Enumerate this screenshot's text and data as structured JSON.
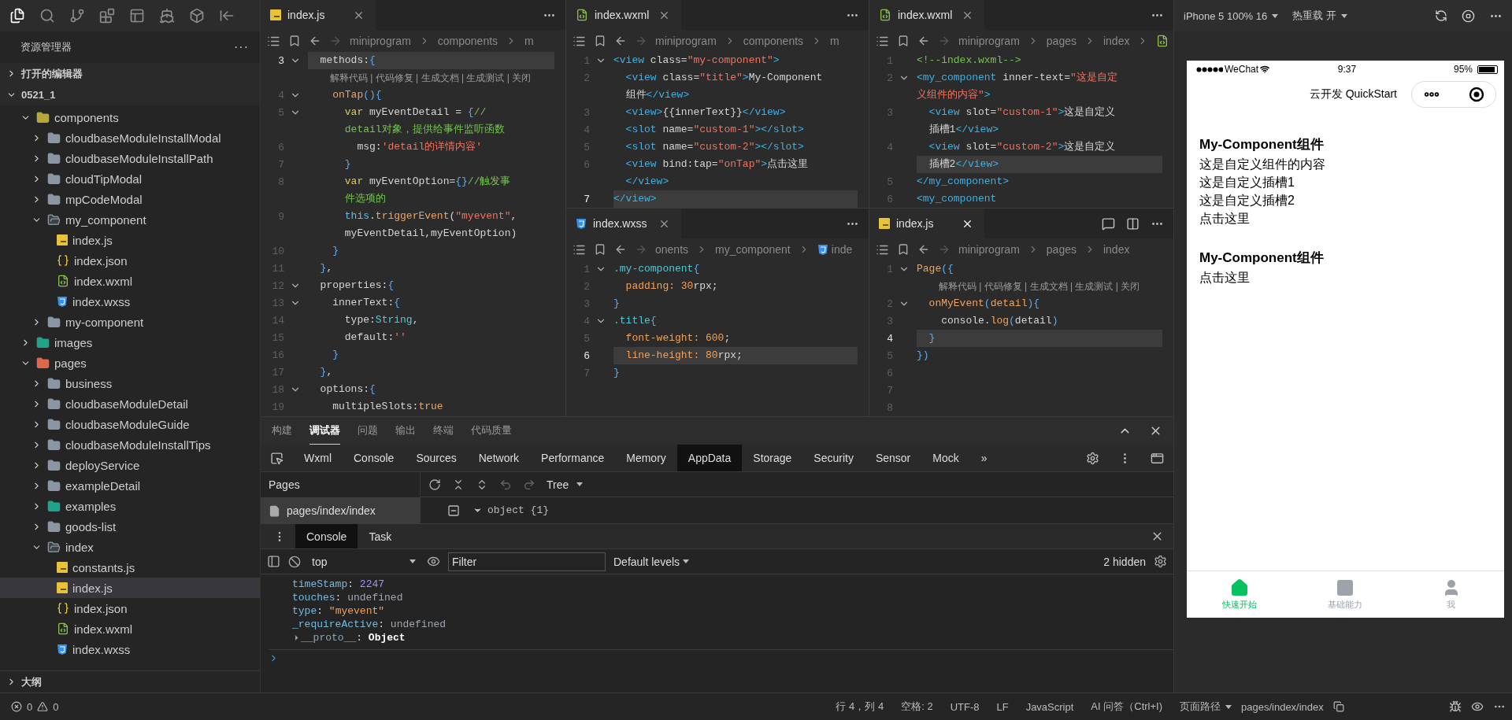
{
  "activity_bar": [
    {
      "selected": true
    },
    {
      "selected": false
    },
    {
      "selected": false
    },
    {
      "selected": false
    },
    {
      "selected": false
    },
    {
      "selected": false
    },
    {
      "selected": false
    },
    {
      "selected": false
    }
  ],
  "sidebar": {
    "title": "资源管理器",
    "more": "···",
    "sections": [
      {
        "label": "打开的编辑器",
        "expanded": false
      },
      {
        "label": "0521_1",
        "expanded": true
      }
    ],
    "tree": [
      {
        "name": "components",
        "kind": "components",
        "expanded": true,
        "selected": false,
        "children": [
          {
            "name": "cloudbaseModuleInstallModal",
            "kind": "folder",
            "expanded": false,
            "selected": false
          },
          {
            "name": "cloudbaseModuleInstallPath",
            "kind": "folder",
            "expanded": false,
            "selected": false
          },
          {
            "name": "cloudTipModal",
            "kind": "folder",
            "expanded": false,
            "selected": false
          },
          {
            "name": "mpCodeModal",
            "kind": "folder",
            "expanded": false,
            "selected": false
          },
          {
            "name": "my_component",
            "kind": "folder",
            "expanded": true,
            "selected": false,
            "children": [
              {
                "name": "index.js",
                "kind": "js",
                "selected": false
              },
              {
                "name": "index.json",
                "kind": "json",
                "selected": false
              },
              {
                "name": "index.wxml",
                "kind": "wxml",
                "selected": false
              },
              {
                "name": "index.wxss",
                "kind": "wxss",
                "selected": false
              }
            ]
          },
          {
            "name": "my-component",
            "kind": "folder",
            "expanded": false,
            "selected": false
          }
        ]
      },
      {
        "name": "images",
        "kind": "images",
        "expanded": false,
        "selected": false
      },
      {
        "name": "pages",
        "kind": "pages",
        "expanded": true,
        "selected": false,
        "children": [
          {
            "name": "business",
            "kind": "folder",
            "expanded": false,
            "selected": false
          },
          {
            "name": "cloudbaseModuleDetail",
            "kind": "folder",
            "expanded": false,
            "selected": false
          },
          {
            "name": "cloudbaseModuleGuide",
            "kind": "folder",
            "expanded": false,
            "selected": false
          },
          {
            "name": "cloudbaseModuleInstallTips",
            "kind": "folder",
            "expanded": false,
            "selected": false
          },
          {
            "name": "deployService",
            "kind": "folder",
            "expanded": false,
            "selected": false
          },
          {
            "name": "exampleDetail",
            "kind": "folder",
            "expanded": false,
            "selected": false
          },
          {
            "name": "examples",
            "kind": "images",
            "expanded": false,
            "selected": false
          },
          {
            "name": "goods-list",
            "kind": "folder",
            "expanded": false,
            "selected": false
          },
          {
            "name": "index",
            "kind": "folder",
            "expanded": true,
            "selected": false,
            "children": [
              {
                "name": "constants.js",
                "kind": "js",
                "selected": false
              },
              {
                "name": "index.js",
                "kind": "js",
                "selected": true
              },
              {
                "name": "index.json",
                "kind": "json",
                "selected": false
              },
              {
                "name": "index.wxml",
                "kind": "wxml",
                "selected": false
              },
              {
                "name": "index.wxss",
                "kind": "wxss",
                "selected": false
              }
            ]
          }
        ]
      }
    ],
    "outline": {
      "label": "大纲",
      "expanded": false
    }
  },
  "editor_groups": [
    {
      "panes": [
        {
          "tab": {
            "label": "index.js",
            "kind": "js",
            "selected": true
          },
          "focused": false,
          "breadcrumb": [
            {
              "label": "miniprogram"
            },
            {
              "label": "components"
            },
            {
              "label": "m"
            }
          ],
          "lines": [
            {
              "kind": "code",
              "num": "3",
              "fold": true,
              "current": true,
              "tokens": [
                {
                  "kind": "plain",
                  "text": "  methods:"
                },
                {
                  "kind": "br",
                  "text": "{"
                }
              ]
            },
            {
              "kind": "lens",
              "text": "解释代码 | 代码修复 | 生成文档 | 生成测试 | 关闭"
            },
            {
              "kind": "code",
              "num": "4",
              "fold": true,
              "current": false,
              "tokens": [
                {
                  "kind": "fn",
                  "text": "    onTap"
                },
                {
                  "kind": "br",
                  "text": "(){"
                }
              ]
            },
            {
              "kind": "code",
              "num": "5",
              "fold": true,
              "current": false,
              "tokens": [
                {
                  "kind": "kw",
                  "text": "      var"
                },
                {
                  "kind": "plain",
                  "text": " myEventDetail = "
                },
                {
                  "kind": "br",
                  "text": "{"
                },
                {
                  "kind": "com",
                  "text": "//"
                }
              ]
            },
            {
              "kind": "wrap",
              "current": false,
              "tokens": [
                {
                  "kind": "com",
                  "text": "      detail对象，提供给事件监听函数"
                }
              ]
            },
            {
              "kind": "code",
              "num": "6",
              "fold": false,
              "current": false,
              "tokens": [
                {
                  "kind": "plain",
                  "text": "        msg:"
                },
                {
                  "kind": "str",
                  "text": "'detail的详情内容'"
                }
              ]
            },
            {
              "kind": "code",
              "num": "7",
              "fold": false,
              "current": false,
              "tokens": [
                {
                  "kind": "br",
                  "text": "      }"
                }
              ]
            },
            {
              "kind": "code",
              "num": "8",
              "fold": false,
              "current": false,
              "tokens": [
                {
                  "kind": "kw",
                  "text": "      var"
                },
                {
                  "kind": "plain",
                  "text": " myEventOption="
                },
                {
                  "kind": "br",
                  "text": "{}"
                },
                {
                  "kind": "com",
                  "text": "//触发事"
                }
              ]
            },
            {
              "kind": "wrap",
              "current": false,
              "tokens": [
                {
                  "kind": "com",
                  "text": "      件选项的"
                }
              ]
            },
            {
              "kind": "code",
              "num": "9",
              "fold": false,
              "current": false,
              "tokens": [
                {
                  "kind": "this",
                  "text": "      this"
                },
                {
                  "kind": "plain",
                  "text": "."
                },
                {
                  "kind": "fn",
                  "text": "triggerEvent"
                },
                {
                  "kind": "plain",
                  "text": "("
                },
                {
                  "kind": "str",
                  "text": "\"myevent\""
                },
                {
                  "kind": "plain",
                  "text": ","
                }
              ]
            },
            {
              "kind": "wrap",
              "current": false,
              "tokens": [
                {
                  "kind": "plain",
                  "text": "      myEventDetail,myEventOption)"
                }
              ]
            },
            {
              "kind": "code",
              "num": "10",
              "fold": false,
              "current": false,
              "tokens": [
                {
                  "kind": "br",
                  "text": "    }"
                }
              ]
            },
            {
              "kind": "code",
              "num": "11",
              "fold": false,
              "current": false,
              "tokens": [
                {
                  "kind": "br",
                  "text": "  }"
                },
                {
                  "kind": "plain",
                  "text": ","
                }
              ]
            },
            {
              "kind": "code",
              "num": "12",
              "fold": true,
              "current": false,
              "tokens": [
                {
                  "kind": "plain",
                  "text": "  properties:"
                },
                {
                  "kind": "br",
                  "text": "{"
                }
              ]
            },
            {
              "kind": "code",
              "num": "13",
              "fold": true,
              "current": false,
              "tokens": [
                {
                  "kind": "plain",
                  "text": "    innerText:"
                },
                {
                  "kind": "br",
                  "text": "{"
                }
              ]
            },
            {
              "kind": "code",
              "num": "14",
              "fold": false,
              "current": false,
              "tokens": [
                {
                  "kind": "plain",
                  "text": "      type:"
                },
                {
                  "kind": "type",
                  "text": "String"
                },
                {
                  "kind": "plain",
                  "text": ","
                }
              ]
            },
            {
              "kind": "code",
              "num": "15",
              "fold": false,
              "current": false,
              "tokens": [
                {
                  "kind": "plain",
                  "text": "      default:"
                },
                {
                  "kind": "str",
                  "text": "''"
                }
              ]
            },
            {
              "kind": "code",
              "num": "16",
              "fold": false,
              "current": false,
              "tokens": [
                {
                  "kind": "br",
                  "text": "    }"
                }
              ]
            },
            {
              "kind": "code",
              "num": "17",
              "fold": false,
              "current": false,
              "tokens": [
                {
                  "kind": "br",
                  "text": "  }"
                },
                {
                  "kind": "plain",
                  "text": ","
                }
              ]
            },
            {
              "kind": "code",
              "num": "18",
              "fold": true,
              "current": false,
              "tokens": [
                {
                  "kind": "plain",
                  "text": "  options:"
                },
                {
                  "kind": "br",
                  "text": "{"
                }
              ]
            },
            {
              "kind": "code",
              "num": "19",
              "fold": false,
              "current": false,
              "tokens": [
                {
                  "kind": "plain",
                  "text": "    multipleSlots:"
                },
                {
                  "kind": "fn",
                  "text": "true"
                }
              ]
            }
          ]
        }
      ]
    },
    {
      "panes": [
        {
          "tab": {
            "label": "index.wxml",
            "kind": "wxml",
            "selected": true
          },
          "focused": false,
          "breadcrumb": [
            {
              "label": "miniprogram"
            },
            {
              "label": "components"
            },
            {
              "label": "m"
            }
          ],
          "lines": [
            {
              "kind": "code",
              "num": "1",
              "fold": true,
              "current": false,
              "tokens": [
                {
                  "kind": "tag",
                  "text": "<view"
                },
                {
                  "kind": "plain",
                  "text": " class="
                },
                {
                  "kind": "str",
                  "text": "\"my-component\""
                },
                {
                  "kind": "tag",
                  "text": ">"
                }
              ]
            },
            {
              "kind": "code",
              "num": "2",
              "fold": false,
              "current": false,
              "tokens": [
                {
                  "kind": "tag",
                  "text": "  <view"
                },
                {
                  "kind": "plain",
                  "text": " class="
                },
                {
                  "kind": "str",
                  "text": "\"title\""
                },
                {
                  "kind": "tag",
                  "text": ">"
                },
                {
                  "kind": "plain",
                  "text": "My-Component"
                }
              ]
            },
            {
              "kind": "wrap",
              "current": false,
              "tokens": [
                {
                  "kind": "plain",
                  "text": "  组件"
                },
                {
                  "kind": "tag",
                  "text": "</view>"
                }
              ]
            },
            {
              "kind": "code",
              "num": "3",
              "fold": false,
              "current": false,
              "tokens": [
                {
                  "kind": "tag",
                  "text": "  <view>"
                },
                {
                  "kind": "plain",
                  "text": "{{innerText}}"
                },
                {
                  "kind": "tag",
                  "text": "</view>"
                }
              ]
            },
            {
              "kind": "code",
              "num": "4",
              "fold": false,
              "current": false,
              "tokens": [
                {
                  "kind": "tag",
                  "text": "  <slot"
                },
                {
                  "kind": "plain",
                  "text": " name="
                },
                {
                  "kind": "str",
                  "text": "\"custom-1\""
                },
                {
                  "kind": "tag",
                  "text": "></slot>"
                }
              ]
            },
            {
              "kind": "code",
              "num": "5",
              "fold": false,
              "current": false,
              "tokens": [
                {
                  "kind": "tag",
                  "text": "  <slot"
                },
                {
                  "kind": "plain",
                  "text": " name="
                },
                {
                  "kind": "str",
                  "text": "\"custom-2\""
                },
                {
                  "kind": "tag",
                  "text": "></slot>"
                }
              ]
            },
            {
              "kind": "code",
              "num": "6",
              "fold": false,
              "current": false,
              "tokens": [
                {
                  "kind": "tag",
                  "text": "  <view"
                },
                {
                  "kind": "plain",
                  "text": " bind:tap="
                },
                {
                  "kind": "str",
                  "text": "\"onTap\""
                },
                {
                  "kind": "tag",
                  "text": ">"
                },
                {
                  "kind": "plain",
                  "text": "点击这里"
                }
              ]
            },
            {
              "kind": "wrap",
              "current": false,
              "tokens": [
                {
                  "kind": "tag",
                  "text": "  </view>"
                }
              ]
            },
            {
              "kind": "code",
              "num": "7",
              "fold": false,
              "current": true,
              "tokens": [
                {
                  "kind": "tag",
                  "text": "</view>"
                }
              ]
            }
          ]
        },
        {
          "tab": {
            "label": "index.wxss",
            "kind": "wxss",
            "selected": true
          },
          "focused": false,
          "breadcrumb": [
            {
              "label": "onents"
            },
            {
              "label": "my_component"
            },
            {
              "label": "inde",
              "kind": "wxss"
            }
          ],
          "lines": [
            {
              "kind": "code",
              "num": "1",
              "fold": true,
              "current": false,
              "tokens": [
                {
                  "kind": "sel",
                  "text": ".my-component"
                },
                {
                  "kind": "br",
                  "text": "{"
                }
              ]
            },
            {
              "kind": "code",
              "num": "2",
              "fold": false,
              "current": false,
              "tokens": [
                {
                  "kind": "prop",
                  "text": "  padding:"
                },
                {
                  "kind": "num",
                  "text": " 30"
                },
                {
                  "kind": "plain",
                  "text": "rpx;"
                }
              ]
            },
            {
              "kind": "code",
              "num": "3",
              "fold": false,
              "current": false,
              "tokens": [
                {
                  "kind": "br",
                  "text": "}"
                }
              ]
            },
            {
              "kind": "code",
              "num": "4",
              "fold": true,
              "current": false,
              "tokens": [
                {
                  "kind": "sel",
                  "text": ".title"
                },
                {
                  "kind": "br",
                  "text": "{"
                }
              ]
            },
            {
              "kind": "code",
              "num": "5",
              "fold": false,
              "current": false,
              "tokens": [
                {
                  "kind": "prop",
                  "text": "  font-weight:"
                },
                {
                  "kind": "num",
                  "text": " 600"
                },
                {
                  "kind": "plain",
                  "text": ";"
                }
              ]
            },
            {
              "kind": "code",
              "num": "6",
              "fold": false,
              "current": true,
              "tokens": [
                {
                  "kind": "prop",
                  "text": "  line-height:"
                },
                {
                  "kind": "num",
                  "text": " 80"
                },
                {
                  "kind": "plain",
                  "text": "rpx;"
                }
              ]
            },
            {
              "kind": "code",
              "num": "7",
              "fold": false,
              "current": false,
              "tokens": [
                {
                  "kind": "br",
                  "text": "}"
                }
              ]
            }
          ]
        }
      ]
    },
    {
      "panes": [
        {
          "tab": {
            "label": "index.wxml",
            "kind": "wxml",
            "selected": true
          },
          "focused": false,
          "breadcrumb": [
            {
              "label": "miniprogram"
            },
            {
              "label": "pages"
            },
            {
              "label": "index"
            },
            {
              "kind": "wxml"
            }
          ],
          "lines": [
            {
              "kind": "code",
              "num": "1",
              "fold": false,
              "current": false,
              "tokens": [
                {
                  "kind": "com",
                  "text": "<!--index.wxml-->"
                }
              ]
            },
            {
              "kind": "code",
              "num": "2",
              "fold": true,
              "current": false,
              "tokens": [
                {
                  "kind": "tag",
                  "text": "<my_component"
                },
                {
                  "kind": "plain",
                  "text": " inner-text="
                },
                {
                  "kind": "str",
                  "text": "\"这是自定"
                }
              ]
            },
            {
              "kind": "wrap",
              "current": false,
              "tokens": [
                {
                  "kind": "str",
                  "text": "义组件的内容\""
                },
                {
                  "kind": "tag",
                  "text": ">"
                }
              ]
            },
            {
              "kind": "code",
              "num": "3",
              "fold": false,
              "current": false,
              "tokens": [
                {
                  "kind": "tag",
                  "text": "  <view"
                },
                {
                  "kind": "plain",
                  "text": " slot="
                },
                {
                  "kind": "str",
                  "text": "\"custom-1\""
                },
                {
                  "kind": "tag",
                  "text": ">"
                },
                {
                  "kind": "plain",
                  "text": "这是自定义"
                }
              ]
            },
            {
              "kind": "wrap",
              "current": false,
              "tokens": [
                {
                  "kind": "plain",
                  "text": "  插槽1"
                },
                {
                  "kind": "tag",
                  "text": "</view>"
                }
              ]
            },
            {
              "kind": "code",
              "num": "4",
              "fold": false,
              "current": false,
              "tokens": [
                {
                  "kind": "tag",
                  "text": "  <view"
                },
                {
                  "kind": "plain",
                  "text": " slot="
                },
                {
                  "kind": "str",
                  "text": "\"custom-2\""
                },
                {
                  "kind": "tag",
                  "text": ">"
                },
                {
                  "kind": "plain",
                  "text": "这是自定义"
                }
              ]
            },
            {
              "kind": "wrap",
              "current": true,
              "tokens": [
                {
                  "kind": "plain",
                  "text": "  插槽2"
                },
                {
                  "kind": "tag",
                  "text": "</view>"
                }
              ]
            },
            {
              "kind": "code",
              "num": "5",
              "fold": false,
              "current": false,
              "tokens": [
                {
                  "kind": "tag",
                  "text": "</my_component>"
                }
              ]
            },
            {
              "kind": "code",
              "num": "6",
              "fold": false,
              "current": false,
              "tokens": [
                {
                  "kind": "tag",
                  "text": "<my_component"
                }
              ]
            }
          ]
        },
        {
          "tab": {
            "label": "index.js",
            "kind": "js",
            "selected": true
          },
          "focused": true,
          "breadcrumb": [
            {
              "label": "miniprogram"
            },
            {
              "label": "pages"
            },
            {
              "label": "index"
            }
          ],
          "lines": [
            {
              "kind": "code",
              "num": "1",
              "fold": true,
              "current": false,
              "tokens": [
                {
                  "kind": "fn",
                  "text": "Page"
                },
                {
                  "kind": "br",
                  "text": "({"
                }
              ]
            },
            {
              "kind": "lens",
              "text": "解释代码 | 代码修复 | 生成文档 | 生成测试 | 关闭"
            },
            {
              "kind": "code",
              "num": "2",
              "fold": true,
              "current": false,
              "tokens": [
                {
                  "kind": "fn",
                  "text": "  onMyEvent"
                },
                {
                  "kind": "br",
                  "text": "("
                },
                {
                  "kind": "fn",
                  "text": "detail"
                },
                {
                  "kind": "br",
                  "text": "){"
                }
              ]
            },
            {
              "kind": "code",
              "num": "3",
              "fold": false,
              "current": false,
              "tokens": [
                {
                  "kind": "plain",
                  "text": "    console."
                },
                {
                  "kind": "fn",
                  "text": "log"
                },
                {
                  "kind": "br",
                  "text": "("
                },
                {
                  "kind": "plain",
                  "text": "detail"
                },
                {
                  "kind": "br",
                  "text": ")"
                }
              ]
            },
            {
              "kind": "code",
              "num": "4",
              "fold": false,
              "current": true,
              "tokens": [
                {
                  "kind": "br",
                  "text": "  }"
                }
              ]
            },
            {
              "kind": "code",
              "num": "5",
              "fold": false,
              "current": false,
              "tokens": [
                {
                  "kind": "br",
                  "text": "})"
                }
              ]
            },
            {
              "kind": "code",
              "num": "6",
              "fold": false,
              "current": false
            },
            {
              "kind": "code",
              "num": "7",
              "fold": false,
              "current": false
            },
            {
              "kind": "code",
              "num": "8",
              "fold": false,
              "current": false
            }
          ]
        }
      ]
    }
  ],
  "devtools": {
    "panel_tabs": [
      {
        "label": "构建",
        "selected": false
      },
      {
        "label": "调试器",
        "selected": true
      },
      {
        "label": "问题",
        "selected": false
      },
      {
        "label": "输出",
        "selected": false
      },
      {
        "label": "终端",
        "selected": false
      },
      {
        "label": "代码质量",
        "selected": false
      }
    ],
    "tool_tabs": [
      {
        "label": "Wxml",
        "selected": false
      },
      {
        "label": "Console",
        "selected": false
      },
      {
        "label": "Sources",
        "selected": false
      },
      {
        "label": "Network",
        "selected": false
      },
      {
        "label": "Performance",
        "selected": false
      },
      {
        "label": "Memory",
        "selected": false
      },
      {
        "label": "AppData",
        "selected": true
      },
      {
        "label": "Storage",
        "selected": false
      },
      {
        "label": "Security",
        "selected": false
      },
      {
        "label": "Sensor",
        "selected": false
      },
      {
        "label": "Mock",
        "selected": false
      }
    ],
    "more_tabs": "»",
    "pages": {
      "title": "Pages",
      "items": [
        {
          "label": "pages/index/index",
          "selected": true
        }
      ]
    },
    "appdata": {
      "view": "Tree",
      "root": {
        "label": "object {1}",
        "expanded": true
      }
    },
    "drawer_tabs": [
      {
        "label": "Console",
        "selected": true
      },
      {
        "label": "Task",
        "selected": false
      }
    ],
    "console": {
      "context": "top",
      "filter": {
        "placeholder": "Filter"
      },
      "levels": "Default levels",
      "hidden": "2 hidden",
      "lines": [
        {
          "tokens": [
            {
              "kind": "key",
              "text": "timeStamp"
            },
            {
              "kind": "plain",
              "text": ": "
            },
            {
              "kind": "cnum",
              "text": "2247"
            }
          ]
        },
        {
          "tokens": [
            {
              "kind": "key",
              "text": "touches"
            },
            {
              "kind": "plain",
              "text": ": "
            },
            {
              "kind": "undef",
              "text": "undefined"
            }
          ]
        },
        {
          "tokens": [
            {
              "kind": "key",
              "text": "type"
            },
            {
              "kind": "plain",
              "text": ": "
            },
            {
              "kind": "cstr",
              "text": "\"myevent\""
            }
          ]
        },
        {
          "tokens": [
            {
              "kind": "key",
              "text": "_requireActive"
            },
            {
              "kind": "plain",
              "text": ": "
            },
            {
              "kind": "undef",
              "text": "undefined"
            }
          ]
        },
        {
          "expanded": false,
          "tokens": [
            {
              "kind": "dimkey",
              "text": "__proto__"
            },
            {
              "kind": "plain",
              "text": ": "
            },
            {
              "kind": "obj",
              "text": "Object"
            }
          ]
        }
      ]
    }
  },
  "simulator": {
    "device": "iPhone 5 100% 16",
    "hot_reload": "热重载 开",
    "status": {
      "carrier": "WeChat",
      "time": "9:37",
      "battery": "95%"
    },
    "nav_title": "云开发 QuickStart",
    "components": [
      {
        "title": "My-Component组件",
        "lines": [
          "这是自定义组件的内容",
          "这是自定义插槽1",
          "这是自定义插槽2",
          "点击这里"
        ]
      },
      {
        "title": "My-Component组件",
        "lines": [
          "点击这里"
        ]
      }
    ],
    "tabbar": [
      {
        "label": "快速开始",
        "selected": true
      },
      {
        "label": "基础能力",
        "selected": false
      },
      {
        "label": "我",
        "selected": false
      }
    ]
  },
  "status_bar": {
    "errors": "0",
    "warnings": "0",
    "items": [
      "行 4，列 4",
      "空格: 2",
      "UTF-8",
      "LF",
      "JavaScript",
      "AI 问答（Ctrl+I)"
    ],
    "page_path_label": "页面路径",
    "page_path": "pages/index/index"
  }
}
